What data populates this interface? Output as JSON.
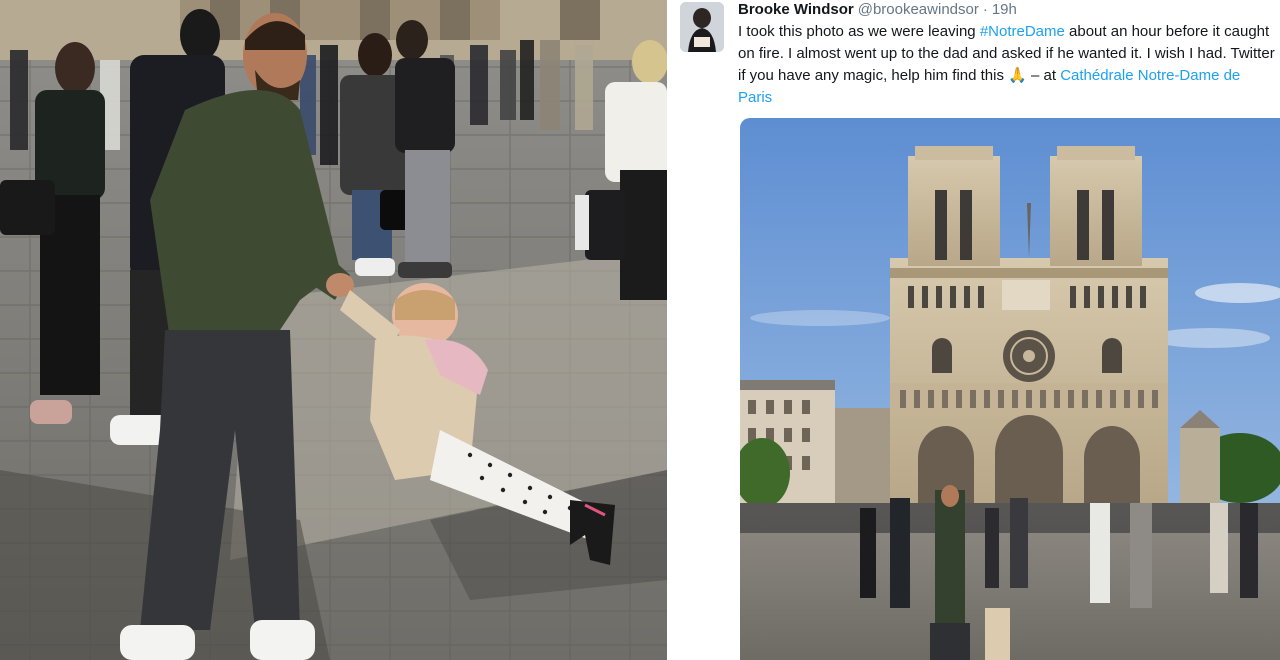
{
  "tweet": {
    "display_name": "Brooke Windsor",
    "handle": "@brookeawindsor",
    "separator": "·",
    "time": "19h",
    "text_part1": "I took this photo as we were leaving ",
    "hashtag": "#NotreDame",
    "text_part2": " about an hour before it caught on fire. I almost went up to the dad and asked if he wanted it. I wish I had. Twitter if you have any magic, help him find this ",
    "emoji": "🙏",
    "text_part3": " – at ",
    "location": "Cathédrale Notre-Dame de Paris"
  },
  "icons": {
    "avatar": "profile-photo",
    "pray": "folded-hands-emoji"
  },
  "colors": {
    "link": "#1da1f2",
    "text": "#14171a",
    "muted": "#657786",
    "sky": "#6c9fd8",
    "stone": "#c8b89a",
    "cobble": "#8c8a85"
  }
}
